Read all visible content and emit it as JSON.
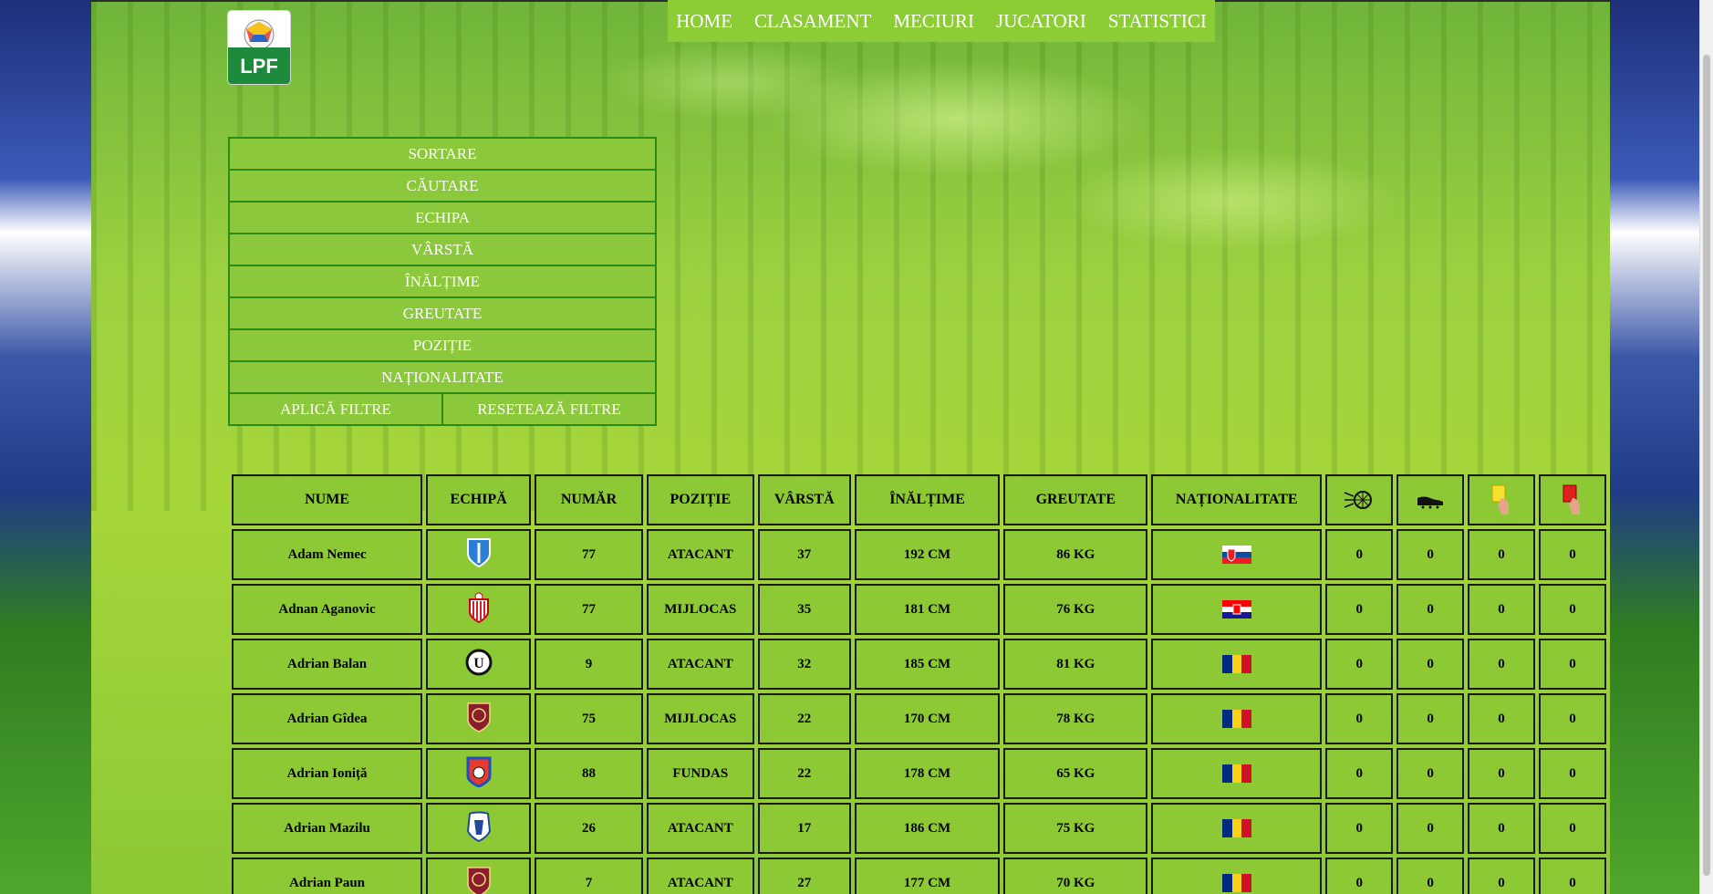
{
  "logo_text": "LPF",
  "nav": [
    "HOME",
    "CLASAMENT",
    "MECIURI",
    "JUCATORI",
    "STATISTICI"
  ],
  "filters": {
    "sortare": "SORTARE",
    "cautare": "CĂUTARE",
    "echipa": "ECHIPA",
    "varsta": "VÂRSTĂ",
    "inaltime": "ÎNĂLȚIME",
    "greutate": "GREUTATE",
    "pozitie": "POZIȚIE",
    "nationalitate": "NAȚIONALITATE",
    "aplica": "APLICĂ FILTRE",
    "reseteaza": "RESETEAZĂ FILTRE"
  },
  "table": {
    "headers": {
      "nume": "NUME",
      "echipa": "ECHIPĂ",
      "numar": "NUMĂR",
      "pozitie": "POZIȚIE",
      "varsta": "VÂRSTĂ",
      "inaltime": "ÎNĂLȚIME",
      "greutate": "GREUTATE",
      "nationalitate": "NAȚIONALITATE"
    },
    "header_icons": [
      "goal-icon",
      "assist-boot-icon",
      "yellow-card-icon",
      "red-card-icon"
    ],
    "rows": [
      {
        "name": "Adam Nemec",
        "crest": "crest-blue",
        "number": "77",
        "position": "ATACANT",
        "age": "37",
        "height": "192 CM",
        "weight": "86 KG",
        "flag": "slovakia",
        "goals": "0",
        "assists": "0",
        "yellow": "0",
        "red": "0"
      },
      {
        "name": "Adnan Aganovic",
        "crest": "crest-red-white",
        "number": "77",
        "position": "MIJLOCAS",
        "age": "35",
        "height": "181 CM",
        "weight": "76 KG",
        "flag": "croatia",
        "goals": "0",
        "assists": "0",
        "yellow": "0",
        "red": "0"
      },
      {
        "name": "Adrian Balan",
        "crest": "crest-u",
        "number": "9",
        "position": "ATACANT",
        "age": "32",
        "height": "185 CM",
        "weight": "81 KG",
        "flag": "romania",
        "goals": "0",
        "assists": "0",
        "yellow": "0",
        "red": "0"
      },
      {
        "name": "Adrian Gîdea",
        "crest": "crest-cfr",
        "number": "75",
        "position": "MIJLOCAS",
        "age": "22",
        "height": "170 CM",
        "weight": "78 KG",
        "flag": "romania",
        "goals": "0",
        "assists": "0",
        "yellow": "0",
        "red": "0"
      },
      {
        "name": "Adrian Ioniță",
        "crest": "crest-chindia",
        "number": "88",
        "position": "FUNDAS",
        "age": "22",
        "height": "178 CM",
        "weight": "65 KG",
        "flag": "romania",
        "goals": "0",
        "assists": "0",
        "yellow": "0",
        "red": "0"
      },
      {
        "name": "Adrian Mazilu",
        "crest": "crest-farul",
        "number": "26",
        "position": "ATACANT",
        "age": "17",
        "height": "186 CM",
        "weight": "75 KG",
        "flag": "romania",
        "goals": "0",
        "assists": "0",
        "yellow": "0",
        "red": "0"
      },
      {
        "name": "Adrian Paun",
        "crest": "crest-cfr",
        "number": "7",
        "position": "ATACANT",
        "age": "27",
        "height": "177 CM",
        "weight": "70 KG",
        "flag": "romania",
        "goals": "0",
        "assists": "0",
        "yellow": "0",
        "red": "0"
      }
    ]
  }
}
